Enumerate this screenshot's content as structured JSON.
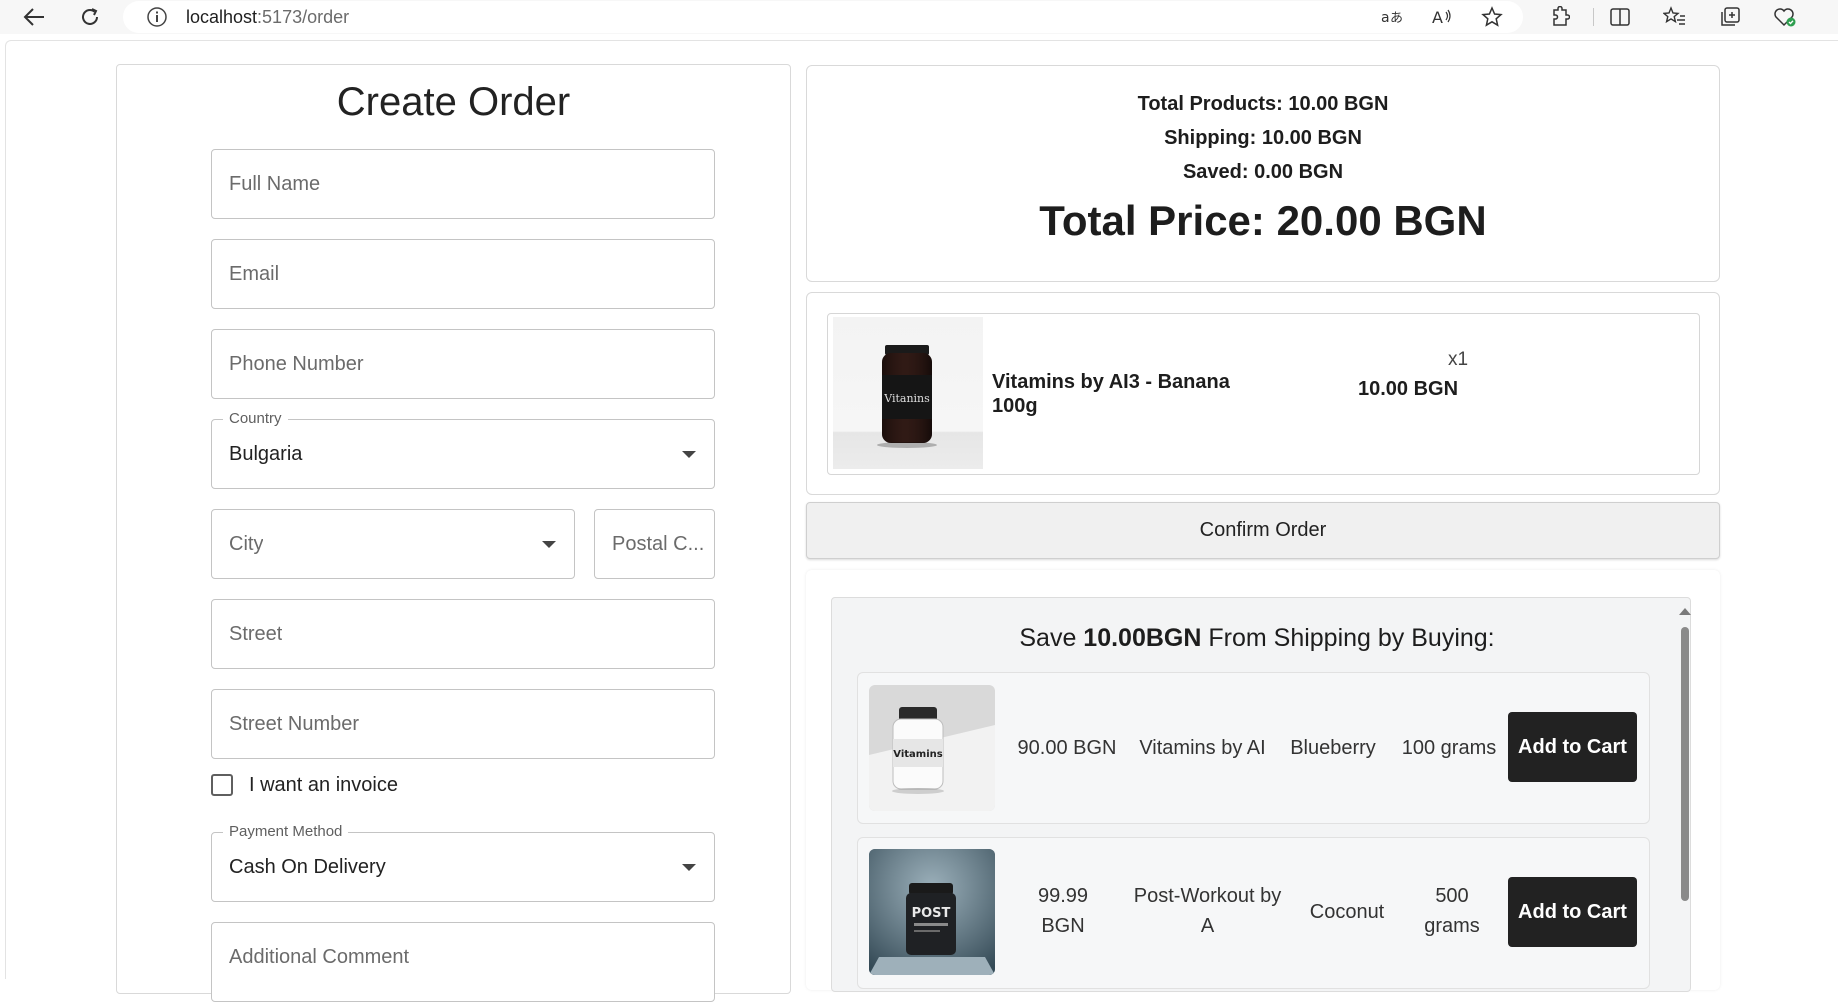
{
  "browser": {
    "url_host": "localhost",
    "url_path": ":5173/order"
  },
  "form": {
    "title": "Create Order",
    "full_name_placeholder": "Full Name",
    "email_placeholder": "Email",
    "phone_placeholder": "Phone Number",
    "country_label": "Country",
    "country_value": "Bulgaria",
    "city_placeholder": "City",
    "postal_placeholder": "Postal C...",
    "street_placeholder": "Street",
    "street_number_placeholder": "Street Number",
    "invoice_label": "I want an invoice",
    "payment_label": "Payment Method",
    "payment_value": "Cash On Delivery",
    "comment_placeholder": "Additional Comment"
  },
  "summary": {
    "total_products": "Total Products: 10.00 BGN",
    "shipping": "Shipping: 10.00 BGN",
    "saved": "Saved: 0.00 BGN",
    "total_price": "Total Price: 20.00 BGN"
  },
  "cart": {
    "items": [
      {
        "name": "Vitamins by AI3 - Banana 100g",
        "quantity": "x1",
        "price": "10.00 BGN",
        "label_text": "Vitanins"
      }
    ]
  },
  "confirm_label": "Confirm Order",
  "upsell": {
    "title_prefix": "Save ",
    "title_amount": "10.00BGN",
    "title_suffix": " From Shipping by Buying:",
    "items": [
      {
        "price": "90.00 BGN",
        "name": "Vitamins by AI",
        "flavor": "Blueberry",
        "size": "100 grams",
        "button": "Add to Cart",
        "label_text": "Vitamins"
      },
      {
        "price": "99.99 BGN",
        "name": "Post-Workout by A",
        "flavor": "Coconut",
        "size": "500 grams",
        "button": "Add to Cart",
        "label_text": "POST"
      }
    ]
  },
  "colors": {
    "add_button_bg": "#222222",
    "confirm_bg": "#f0f0f0",
    "upsell_bg": "#f3f4f5"
  }
}
